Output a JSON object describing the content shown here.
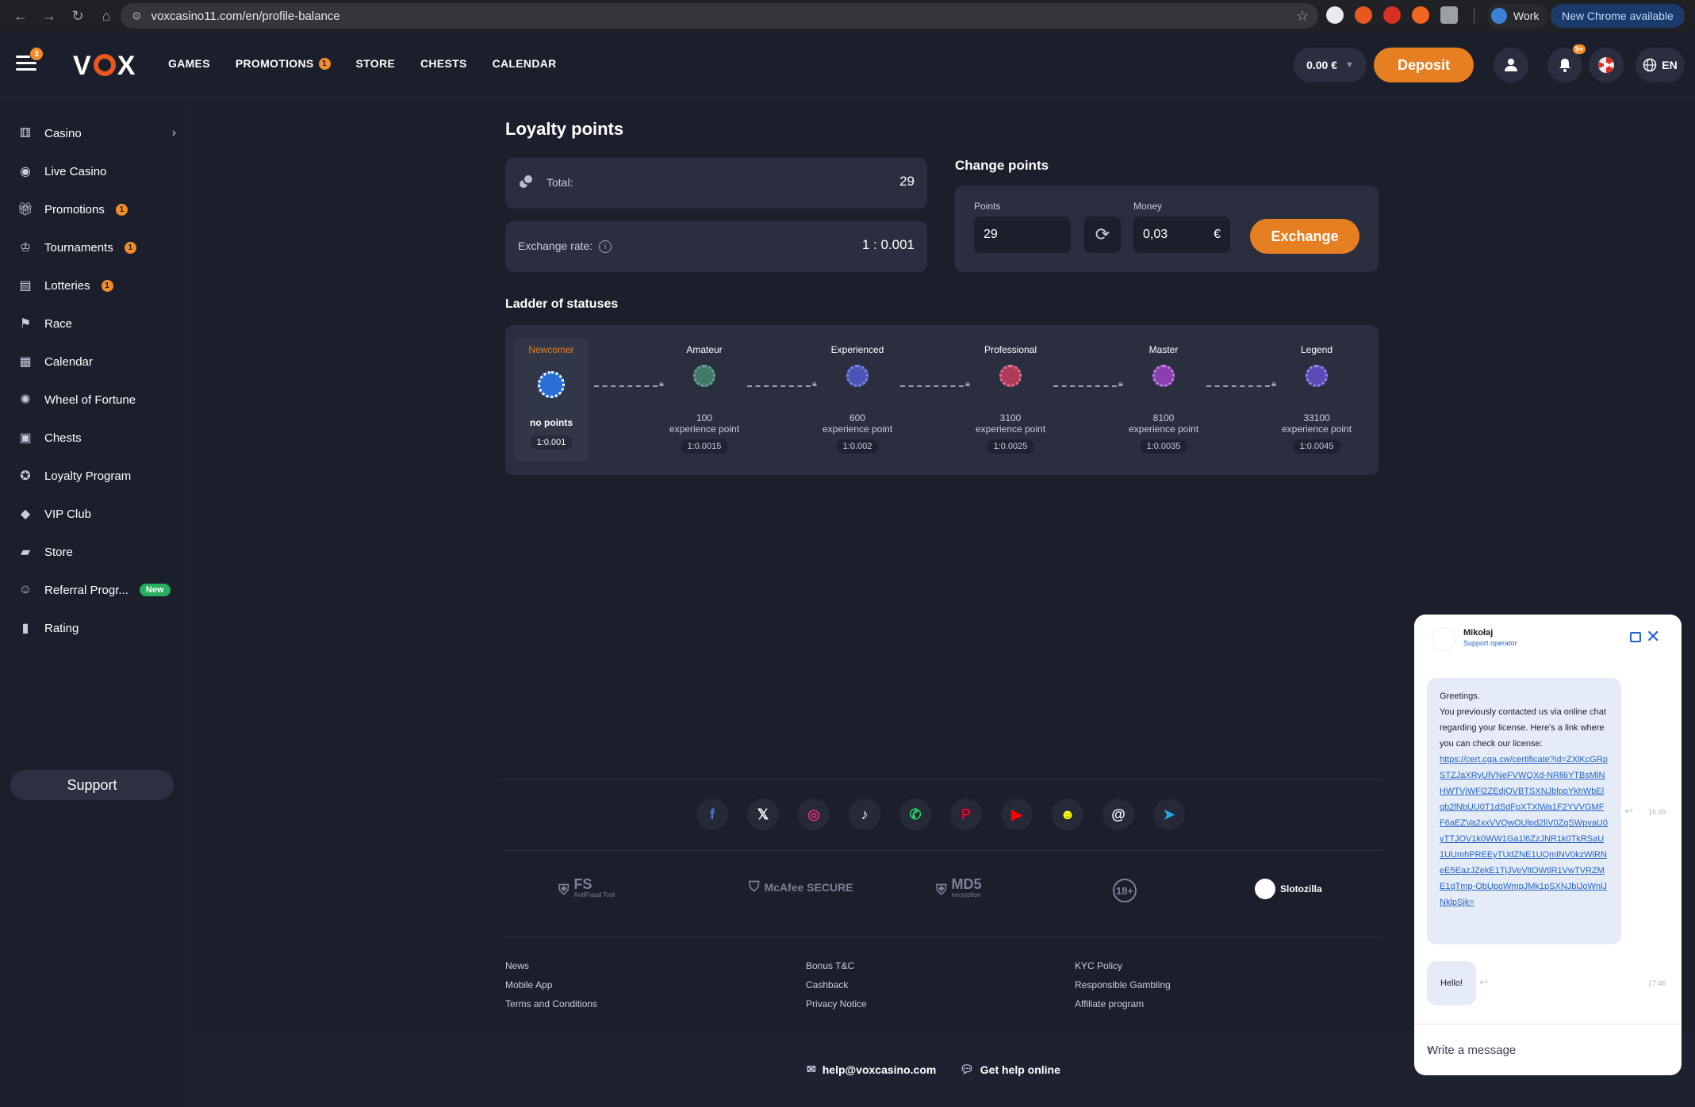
{
  "browser": {
    "url": "voxcasino11.com/en/profile-balance",
    "profile_label": "Work",
    "update_label": "New Chrome available"
  },
  "header": {
    "menu_badge": "3",
    "logo_text": "VOX",
    "nav": [
      {
        "label": "GAMES",
        "badge": ""
      },
      {
        "label": "PROMOTIONS",
        "badge": "1"
      },
      {
        "label": "STORE",
        "badge": ""
      },
      {
        "label": "CHESTS",
        "badge": ""
      },
      {
        "label": "CALENDAR",
        "badge": ""
      }
    ],
    "balance": "0.00 €",
    "deposit_label": "Deposit",
    "notifications_badge": "9+",
    "language": "EN"
  },
  "sidebar": {
    "items": [
      {
        "label": "Casino",
        "icon": "dice-icon",
        "badge": ""
      },
      {
        "label": "Live Casino",
        "icon": "live-icon",
        "badge": ""
      },
      {
        "label": "Promotions",
        "icon": "gift-icon",
        "badge": "1"
      },
      {
        "label": "Tournaments",
        "icon": "trophy-icon",
        "badge": "1"
      },
      {
        "label": "Lotteries",
        "icon": "lottery-icon",
        "badge": "1"
      },
      {
        "label": "Race",
        "icon": "flag-icon",
        "badge": ""
      },
      {
        "label": "Calendar",
        "icon": "calendar-icon",
        "badge": ""
      },
      {
        "label": "Wheel of Fortune",
        "icon": "wheel-icon",
        "badge": ""
      },
      {
        "label": "Chests",
        "icon": "chest-icon",
        "badge": ""
      },
      {
        "label": "Loyalty Program",
        "icon": "loyalty-icon",
        "badge": ""
      },
      {
        "label": "VIP Club",
        "icon": "diamond-icon",
        "badge": ""
      },
      {
        "label": "Store",
        "icon": "bag-icon",
        "badge": ""
      },
      {
        "label": "Referral Progr...",
        "icon": "referral-icon",
        "badge": "New"
      },
      {
        "label": "Rating",
        "icon": "rating-icon",
        "badge": ""
      }
    ],
    "support_label": "Support"
  },
  "main": {
    "title": "Loyalty points",
    "total_label": "Total:",
    "total_value": "29",
    "rate_label": "Exchange rate:",
    "rate_value": "1 : 0.001",
    "change_title": "Change points",
    "points_label": "Points",
    "points_value": "29",
    "money_label": "Money",
    "money_value": "0,03",
    "currency": "€",
    "exchange_label": "Exchange",
    "ladder_title": "Ladder of statuses",
    "statuses": [
      {
        "name": "Newcomer",
        "points": "no points",
        "unit": "",
        "rate": "1:0.001",
        "color": "#2b6fd6"
      },
      {
        "name": "Amateur",
        "points": "100",
        "unit": "experience point",
        "rate": "1:0.0015",
        "color": "#3f7a68"
      },
      {
        "name": "Experienced",
        "points": "600",
        "unit": "experience point",
        "rate": "1:0.002",
        "color": "#4a55b8"
      },
      {
        "name": "Professional",
        "points": "3100",
        "unit": "experience point",
        "rate": "1:0.0025",
        "color": "#b03a5a"
      },
      {
        "name": "Master",
        "points": "8100",
        "unit": "experience point",
        "rate": "1:0.0035",
        "color": "#8a3fb0"
      },
      {
        "name": "Legend",
        "points": "33100",
        "unit": "experience point",
        "rate": "1:0.0045",
        "color": "#5b4bb8"
      }
    ]
  },
  "footer": {
    "socials": [
      "facebook-icon",
      "x-icon",
      "instagram-icon",
      "tiktok-icon",
      "whatsapp-icon",
      "pinterest-icon",
      "youtube-icon",
      "snapchat-icon",
      "threads-icon",
      "telegram-icon"
    ],
    "partners": [
      "FS",
      "McAfee SECURE",
      "MD5",
      "18+",
      "Slotozilla"
    ],
    "partner_subs": [
      "AntiFraud Tool",
      "",
      "encryption",
      "",
      ""
    ],
    "links_col1": [
      "News",
      "Mobile App",
      "Terms and Conditions"
    ],
    "links_col2": [
      "Bonus T&C",
      "Cashback",
      "Privacy Notice"
    ],
    "links_col3": [
      "KYC Policy",
      "Responsible Gambling",
      "Affiliate program"
    ],
    "email": "help@voxcasino.com",
    "help_online": "Get help online"
  },
  "chat": {
    "operator": "Mikołaj",
    "role": "Support operator",
    "msg1_lines": [
      "Greetings.",
      "You previously contacted us via online chat regarding your license. Here's a link where you can check our license:"
    ],
    "msg1_link": "https://cert.cga.cw/certificate?id=ZXlKcGRpSTZJaXRyUlVNeFVWQXd-NRll6YTBsMlNHWTVjWFl2ZEdjOVBTSXNJblpoYkhWbElqb2lNbUU0T1dSdFpXTXlWa1F2YVVGMFF6aEZVa2xxVVQwOUlpd2liV0ZqSWpvaU0yTTJOV1k0WW1Ga1l6ZzJNR1k0TkRSaU1UUmhPREEyTUdZNE1UQmlNV0kzWlRNeE5EazJZekE1TjJVeVltOWtlR1VwTVRZME1qTmp-ObUpoWmpJMk1pSXNJblJoWnlJNklpSjk=",
    "msg1_time": "16:49",
    "msg2": "Hello!",
    "msg2_time": "17:46",
    "input_placeholder": "Write a message"
  }
}
